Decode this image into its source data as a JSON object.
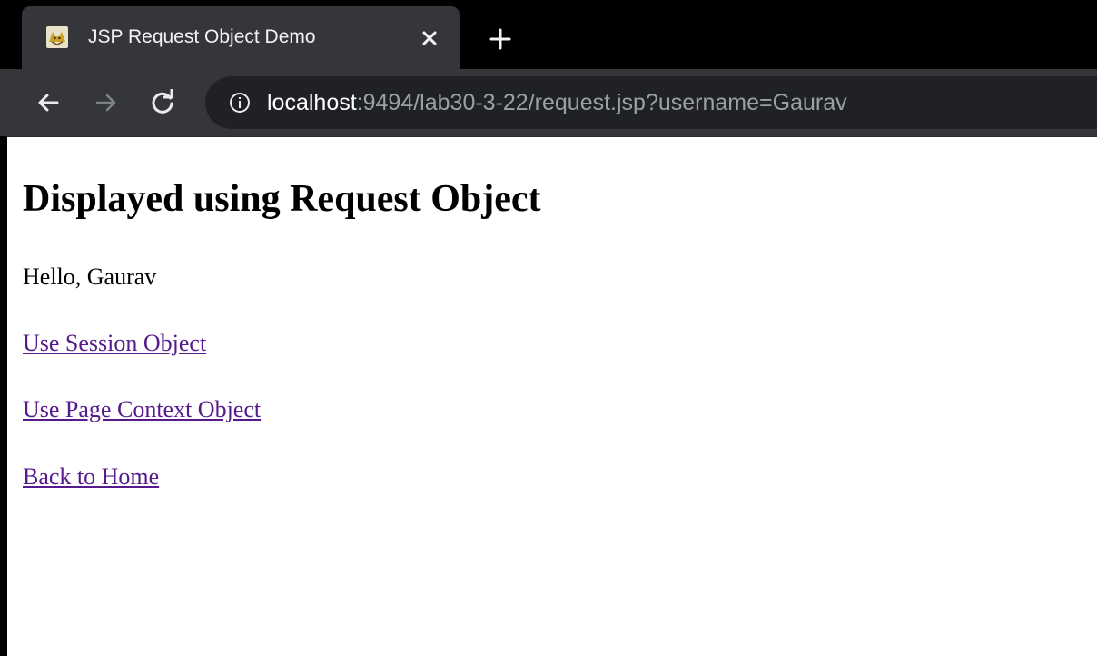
{
  "browser": {
    "tab": {
      "title": "JSP Request Object Demo",
      "favicon": "tomcat-icon"
    },
    "address": {
      "host": "localhost",
      "rest": ":9494/lab30-3-22/request.jsp?username=Gaurav"
    },
    "icons": {
      "close": "close-icon",
      "new_tab": "plus-icon",
      "back": "back-arrow-icon",
      "forward": "forward-arrow-icon",
      "reload": "reload-icon",
      "info": "info-icon"
    },
    "colors": {
      "tabstrip": "#000000",
      "toolbar": "#35363a",
      "omnibox": "#202124",
      "link": "#551a8b"
    }
  },
  "page": {
    "heading": "Displayed using Request Object",
    "greeting": "Hello, Gaurav",
    "links": [
      "Use Session Object",
      "Use Page Context Object",
      "Back to Home"
    ]
  }
}
